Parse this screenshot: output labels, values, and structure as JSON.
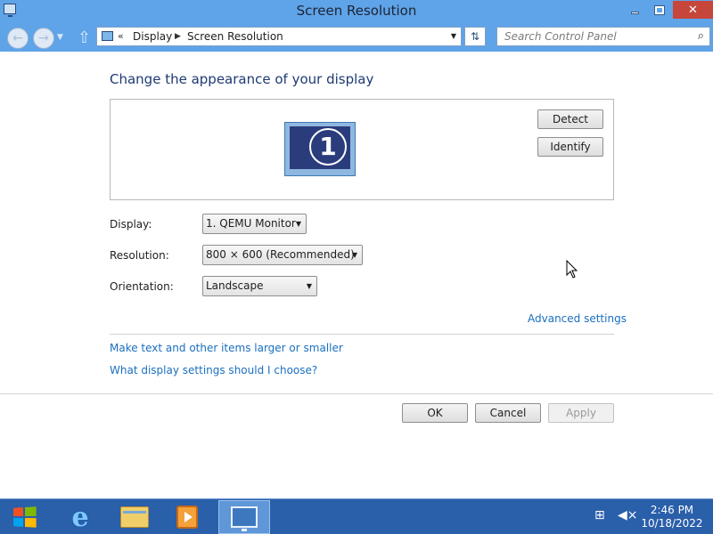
{
  "window": {
    "title": "Screen Resolution",
    "close_glyph": "✕"
  },
  "nav": {
    "breadcrumb_chevron": "«",
    "breadcrumb": [
      "Display",
      "Screen Resolution"
    ],
    "search_placeholder": "Search Control Panel"
  },
  "main": {
    "heading": "Change the appearance of your display",
    "monitor_number": "1",
    "detect_label": "Detect",
    "identify_label": "Identify",
    "display_label": "Display:",
    "display_value": "1. QEMU Monitor",
    "resolution_label": "Resolution:",
    "resolution_value": "800 × 600 (Recommended)",
    "orientation_label": "Orientation:",
    "orientation_value": "Landscape",
    "advanced_link": "Advanced settings",
    "link_text_size": "Make text and other items larger or smaller",
    "link_what_settings": "What display settings should I choose?"
  },
  "footer": {
    "ok_label": "OK",
    "cancel_label": "Cancel",
    "apply_label": "Apply"
  },
  "taskbar": {
    "time": "2:46 PM",
    "date": "10/18/2022",
    "pinned_icons": [
      "internet-explorer-icon",
      "file-explorer-icon",
      "media-player-icon",
      "screen-resolution-icon"
    ]
  },
  "colors": {
    "titlebar": "#5fa3e8",
    "taskbar": "#2a5faa",
    "link": "#1a6fbf",
    "heading": "#1e3a73",
    "close_button": "#c7463b"
  }
}
